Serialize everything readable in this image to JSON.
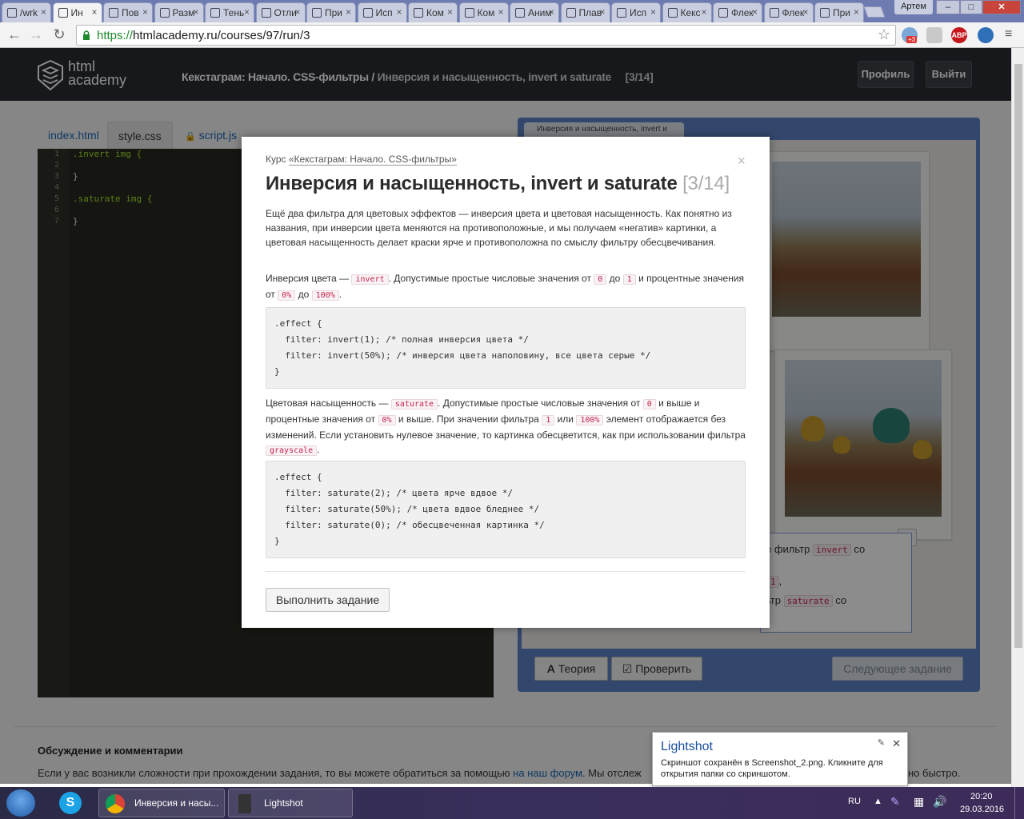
{
  "browser": {
    "tabs": [
      "/wrk",
      "Ин",
      "Пов",
      "Разм",
      "Тень",
      "Отли",
      "При",
      "Исп",
      "Ком",
      "Ком",
      "Аним",
      "Плав",
      "Исп",
      "Кекс",
      "Флек",
      "Флек",
      "При"
    ],
    "window_user": "Артем",
    "window_controls": [
      "–",
      "□",
      "✕"
    ],
    "url_scheme": "https://",
    "url_rest": "htmlacademy.ru/courses/97/run/3",
    "ext_badge": "+3",
    "abp": "ABP"
  },
  "site": {
    "logo_line1": "html",
    "logo_line2": "academy",
    "breadcrumb_course": "Кекстаграм: Начало. CSS-фильтры /",
    "breadcrumb_current": "Инверсия и насыщенность, invert и saturate",
    "breadcrumb_progress": "[3/14]",
    "profile_btn": "Профиль",
    "logout_btn": "Выйти"
  },
  "editor": {
    "tabs": [
      "index.html",
      "style.css",
      "script.js"
    ],
    "line_numbers": [
      "1",
      "2",
      "3",
      "4",
      "5",
      "6",
      "7"
    ],
    "lines": [
      ".invert img {",
      "",
      "}",
      "",
      ".saturate img {",
      "",
      "}"
    ]
  },
  "preview": {
    "tab_title": "Инверсия и насыщенность, invert и",
    "task_line1": "е фильтр",
    "task_chip1": "invert",
    "task_line1_end": "со",
    "task_chip2": "1",
    "task_line3": "ьтр",
    "task_chip3": "saturate",
    "task_line3_end": "со",
    "up_arrow": "⬆",
    "theory_btn": "Теория",
    "check_btn": "Проверить",
    "next_btn": "Следующее задание"
  },
  "modal": {
    "course_prefix": "Курс",
    "course_name": "«Кекстаграм: Начало. CSS-фильтры»",
    "close": "×",
    "title": "Инверсия и насыщенность, invert и saturate",
    "title_progress": "[3/14]",
    "intro": "Ещё два фильтра для цветовых эффектов — инверсия цвета и цветовая насыщенность. Как понятно из названия, при инверсии цвета меняются на противоположные, и мы получаем «негатив» картинки, а цветовая насыщенность делает краски ярче и противоположна по смыслу фильтру обесцвечивания.",
    "invert_p": {
      "t1": "Инверсия цвета —",
      "c1": "invert",
      "t2": ". Допустимые простые числовые значения от",
      "c2": "0",
      "t3": "до",
      "c3": "1",
      "t4": "и процентные значения от",
      "c4": "0%",
      "t5": "до",
      "c5": "100%",
      "t6": "."
    },
    "code1": [
      ".effect {",
      "  filter: invert(1); /* полная инверсия цвета */",
      "  filter: invert(50%); /* инверсия цвета наполовину, все цвета серые */",
      "}"
    ],
    "saturate_p": {
      "t1": "Цветовая насыщенность —",
      "c1": "saturate",
      "t2": ". Допустимые простые числовые значения от",
      "c2": "0",
      "t3": "и выше и процентные значения от",
      "c3": "0%",
      "t4": "и выше. При значении фильтра",
      "c4": "1",
      "t5": "или",
      "c5": "100%",
      "t6": "элемент отображается без изменений. Если установить нулевое значение, то картинка обесцветится, как при использовании фильтра",
      "c6": "grayscale",
      "t7": "."
    },
    "code2": [
      ".effect {",
      "  filter: saturate(2); /* цвета ярче вдвое */",
      "  filter: saturate(50%); /* цвета вдвое бледнее */",
      "  filter: saturate(0); /* обесцвеченная картинка */",
      "}"
    ],
    "run_btn": "Выполнить задание"
  },
  "discussion": {
    "title": "Обсуждение и комментарии",
    "text_start": "Если у вас возникли сложности при прохождении задания, то вы можете обратиться за помощью",
    "link": "на наш форум",
    "text_end": ". Мы отслеж",
    "text_tail": "но быстро."
  },
  "lightshot": {
    "title": "Lightshot",
    "message": "Скриншот сохранён в Screenshot_2.png. Кликните для открытия папки со скриншотом.",
    "close": "✕"
  },
  "taskbar": {
    "chrome_item": "Инверсия и насы...",
    "lightshot_item": "Lightshot",
    "lang": "RU",
    "time": "20:20",
    "date": "29.03.2016"
  }
}
